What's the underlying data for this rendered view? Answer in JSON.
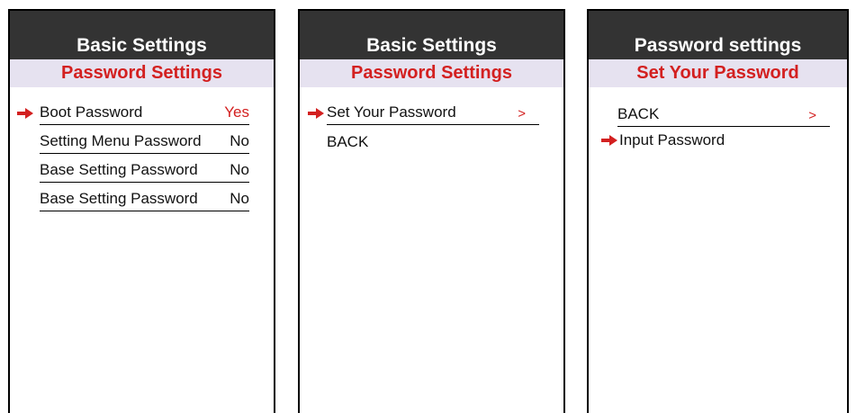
{
  "screens": [
    {
      "header": "Basic Settings",
      "subheader": "Password Settings",
      "items": [
        {
          "label": "Boot Password",
          "value": "Yes"
        },
        {
          "label": "Setting Menu Password",
          "value": "No"
        },
        {
          "label": "Base Setting Password",
          "value": "No"
        },
        {
          "label": "Base Setting Password",
          "value": "No"
        }
      ]
    },
    {
      "header": "Basic Settings",
      "subheader": "Password Settings",
      "items": [
        {
          "label": "Set Your Password",
          "value": ">"
        },
        {
          "label": "BACK"
        }
      ]
    },
    {
      "header": "Password settings",
      "subheader": "Set Your Password",
      "items": [
        {
          "label": "BACK",
          "value": ">"
        },
        {
          "label": "Input Password"
        }
      ]
    }
  ],
  "selected": [
    {
      "screen": 1,
      "item": "Boot Password"
    },
    {
      "screen": 2,
      "item": "Set Your Password"
    },
    {
      "screen": 3,
      "item": "Input Password"
    }
  ],
  "colors": {
    "header_bg": "#333333",
    "subheader_bg": "#e6e2f0",
    "accent_red": "#d32020",
    "arrow_icon": "right-arrow-icon"
  }
}
